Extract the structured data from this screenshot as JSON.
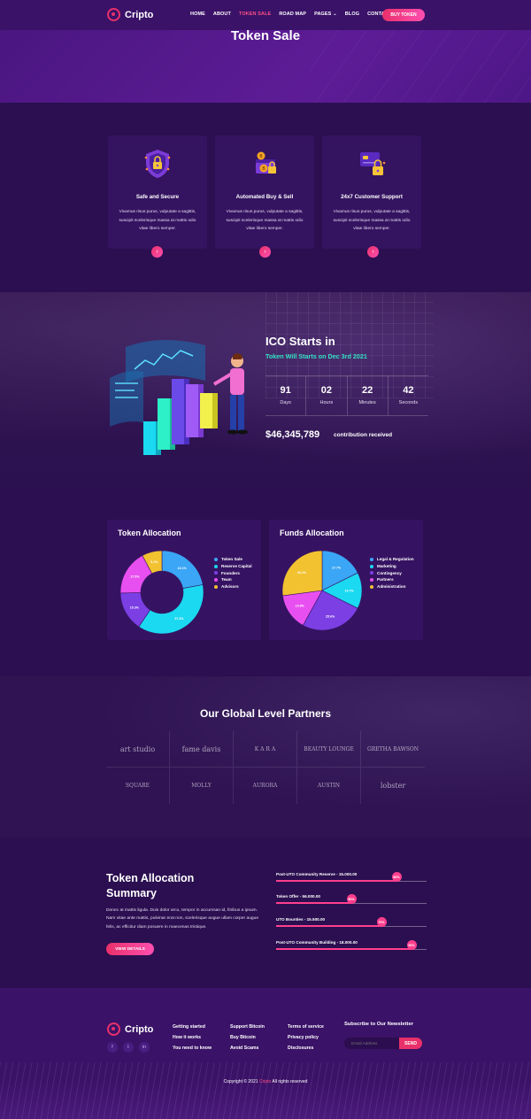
{
  "nav": {
    "brand": "Cripto",
    "items": [
      "HOME",
      "ABOUT",
      "TOKEN SALE",
      "ROAD MAP",
      "PAGES",
      "BLOG",
      "CONTACT"
    ],
    "active": "TOKEN SALE",
    "cta": "BUY TOKEN"
  },
  "hero": {
    "title": "Token Sale"
  },
  "features": [
    {
      "title": "Safe and Secure",
      "text": "Vivamus risus purus, vulputate a sagittis, suscipit scelerisque massa at mattis odio vitae libero semper.",
      "icon": "shield-lock-icon"
    },
    {
      "title": "Automated Buy & Sell",
      "text": "Vivamus risus purus, vulputate a sagittis, suscipit scelerisque massa at mattis odio vitae libero semper.",
      "icon": "wallet-coins-icon"
    },
    {
      "title": "24x7 Customer Support",
      "text": "Vivamus risus purus, vulputate a sagittis, suscipit scelerisque massa at mattis odio vitae libero semper.",
      "icon": "card-lock-icon"
    }
  ],
  "ico": {
    "title": "ICO Starts in",
    "subtitle": "Token Will Starts on Dec 3rd 2021",
    "countdown": [
      {
        "value": "91",
        "label": "Days"
      },
      {
        "value": "02",
        "label": "Hours"
      },
      {
        "value": "22",
        "label": "Minutes"
      },
      {
        "value": "42",
        "label": "Seconds"
      }
    ],
    "amount": "$46,345,789",
    "amount_label": "contribution received"
  },
  "token_allocation": {
    "title": "Token Allocation",
    "legend": [
      {
        "name": "Token Sale",
        "color": "#3aa6f5"
      },
      {
        "name": "Reserve Capital",
        "color": "#1ad9f0"
      },
      {
        "name": "Founders",
        "color": "#7b3fe4"
      },
      {
        "name": "Team",
        "color": "#e84ff0"
      },
      {
        "name": "Advisors",
        "color": "#f2c230"
      }
    ]
  },
  "funds_allocation": {
    "title": "Funds Allocation",
    "legend": [
      {
        "name": "Legal & Regulation",
        "color": "#3aa6f5"
      },
      {
        "name": "Marketing",
        "color": "#1ad9f0"
      },
      {
        "name": "Contingency",
        "color": "#7b3fe4"
      },
      {
        "name": "Partners",
        "color": "#e84ff0"
      },
      {
        "name": "Administration",
        "color": "#f2c230"
      }
    ]
  },
  "chart_data": [
    {
      "type": "pie",
      "title": "Token Allocation",
      "categories": [
        "Token Sale",
        "Reserve Capital",
        "Founders",
        "Team",
        "Advisors"
      ],
      "values": [
        22.1,
        37.3,
        15.3,
        17.5,
        7.8
      ],
      "labels": [
        "22.1%",
        "37.3%",
        "15.3%",
        "17.5%",
        "6.2%"
      ],
      "donut": true,
      "legend": "right"
    },
    {
      "type": "pie",
      "title": "Funds Allocation",
      "categories": [
        "Legal & Regulation",
        "Marketing",
        "Contingency",
        "Partners",
        "Administration"
      ],
      "values": [
        17.7,
        14.7,
        25.6,
        14.9,
        27.1
      ],
      "labels": [
        "17.7%",
        "14.7%",
        "25.6%",
        "14.9%",
        "26.1%"
      ],
      "donut": false,
      "legend": "right"
    }
  ],
  "partners": {
    "title": "Our Global Level Partners",
    "logos": [
      "art studio",
      "fame davis",
      "K A R A",
      "BEAUTY LOUNGE",
      "GRETHA BAWSON",
      "SQUARE",
      "MOLLY",
      "AURORA",
      "AUSTIN",
      "lobster"
    ]
  },
  "summary": {
    "title": "Token Allocation Summary",
    "text": "Donec at mattis ligula. Duis dolor arcu, tempor in accumsan id, finibus a ipsum. Nam vitae ante mattis, pulvinar erat non, scelerisque augue ullam corper augue felis, ac efficitur diam posuere in maecenas tristique.",
    "button": "VIEW DETAILS",
    "bars": [
      {
        "label": "Post-UTO Community Reserve - 15.000.00",
        "percent": 80,
        "badge": "80%"
      },
      {
        "label": "Token Offer - 56.000.00",
        "percent": 50,
        "badge": "50%"
      },
      {
        "label": "UTO Bounties - 15.500.00",
        "percent": 70,
        "badge": "70%"
      },
      {
        "label": "Post-UTO Community Building - 18.000.00",
        "percent": 90,
        "badge": "90%"
      }
    ]
  },
  "footer": {
    "brand": "Cripto",
    "social": [
      "f",
      "t",
      "in"
    ],
    "col1": [
      "Getting started",
      "How it works",
      "You need to know"
    ],
    "col2": [
      "Support Bitcoin",
      "Buy Bitcoin",
      "Avoid Scams"
    ],
    "col3": [
      "Terms of service",
      "Privacy policy",
      "Disclosures"
    ],
    "newsletter_title": "Subscribe to Our Newsletter",
    "email_placeholder": "Email Address",
    "send": "SEND",
    "copyright_pre": "Copyright © 2021",
    "copyright_brand": "Cripto",
    "copyright_post": "All rights reserved"
  }
}
